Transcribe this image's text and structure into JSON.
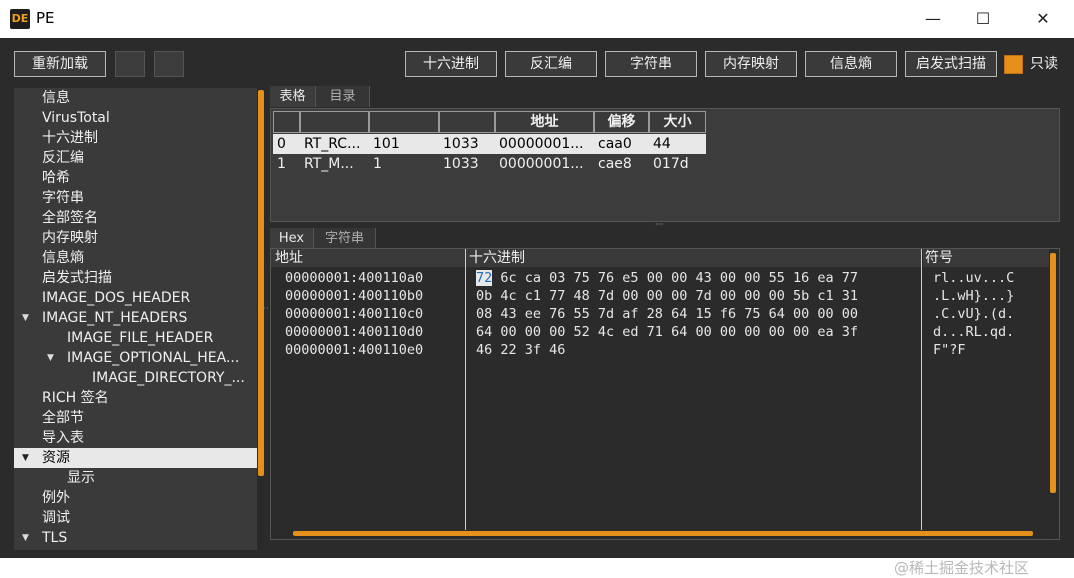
{
  "window": {
    "title": "PE",
    "icon_text": "DE",
    "controls": {
      "minimize": "—",
      "maximize": "☐",
      "close": "✕"
    }
  },
  "toolbar": {
    "reload": "重新加载",
    "hex": "十六进制",
    "disasm": "反汇编",
    "strings": "字符串",
    "memmap": "内存映射",
    "entropy": "信息熵",
    "heuristic": "启发式扫描",
    "readonly": "只读",
    "readonly_checked": true
  },
  "tree": [
    {
      "label": "信息",
      "level": 0
    },
    {
      "label": "VirusTotal",
      "level": 0
    },
    {
      "label": "十六进制",
      "level": 0
    },
    {
      "label": "反汇编",
      "level": 0
    },
    {
      "label": "哈希",
      "level": 0
    },
    {
      "label": "字符串",
      "level": 0
    },
    {
      "label": "全部签名",
      "level": 0
    },
    {
      "label": "内存映射",
      "level": 0
    },
    {
      "label": "信息熵",
      "level": 0
    },
    {
      "label": "启发式扫描",
      "level": 0
    },
    {
      "label": "IMAGE_DOS_HEADER",
      "level": 0
    },
    {
      "label": "IMAGE_NT_HEADERS",
      "level": 0,
      "expanded": true
    },
    {
      "label": "IMAGE_FILE_HEADER",
      "level": 1
    },
    {
      "label": "IMAGE_OPTIONAL_HEA...",
      "level": 1,
      "expanded": true
    },
    {
      "label": "IMAGE_DIRECTORY_...",
      "level": 2
    },
    {
      "label": "RICH 签名",
      "level": 0
    },
    {
      "label": "全部节",
      "level": 0
    },
    {
      "label": "导入表",
      "level": 0
    },
    {
      "label": "资源",
      "level": 0,
      "expanded": true,
      "selected": true
    },
    {
      "label": "显示",
      "level": 1
    },
    {
      "label": "例外",
      "level": 0
    },
    {
      "label": "调试",
      "level": 0
    },
    {
      "label": "TLS",
      "level": 0,
      "expanded": true
    }
  ],
  "upper_tabs": [
    "表格",
    "目录"
  ],
  "table": {
    "headers": [
      "",
      "",
      "",
      "",
      "地址",
      "偏移",
      "大小"
    ],
    "rows": [
      [
        "0",
        "RT_RC...",
        "101",
        "1033",
        "00000001...",
        "caa0",
        "44"
      ],
      [
        "1",
        "RT_M...",
        "1",
        "1033",
        "00000001...",
        "cae8",
        "017d"
      ]
    ]
  },
  "lower_tabs": [
    "Hex",
    "字符串"
  ],
  "hexview": {
    "col_address": "地址",
    "col_hex": "十六进制",
    "col_symbols": "符号",
    "rows": [
      {
        "addr": "00000001:400110a0",
        "first": "72",
        "rest": " 6c ca 03 75 76 e5 00 00 43 00 00 55 16 ea 77",
        "sym": "rl..uv...C"
      },
      {
        "addr": "00000001:400110b0",
        "first": "",
        "rest": "0b 4c c1 77 48 7d 00 00 00 7d 00 00 00 5b c1 31",
        "sym": ".L.wH}...}"
      },
      {
        "addr": "00000001:400110c0",
        "first": "",
        "rest": "08 43 ee 76 55 7d af 28 64 15 f6 75 64 00 00 00",
        "sym": ".C.vU}.(d."
      },
      {
        "addr": "00000001:400110d0",
        "first": "",
        "rest": "64 00 00 00 52 4c ed 71 64 00 00 00 00 00 ea 3f",
        "sym": "d...RL.qd."
      },
      {
        "addr": "00000001:400110e0",
        "first": "",
        "rest": "46 22 3f 46",
        "sym": "F\"?F"
      }
    ]
  },
  "watermark": "@稀土掘金技术社区"
}
